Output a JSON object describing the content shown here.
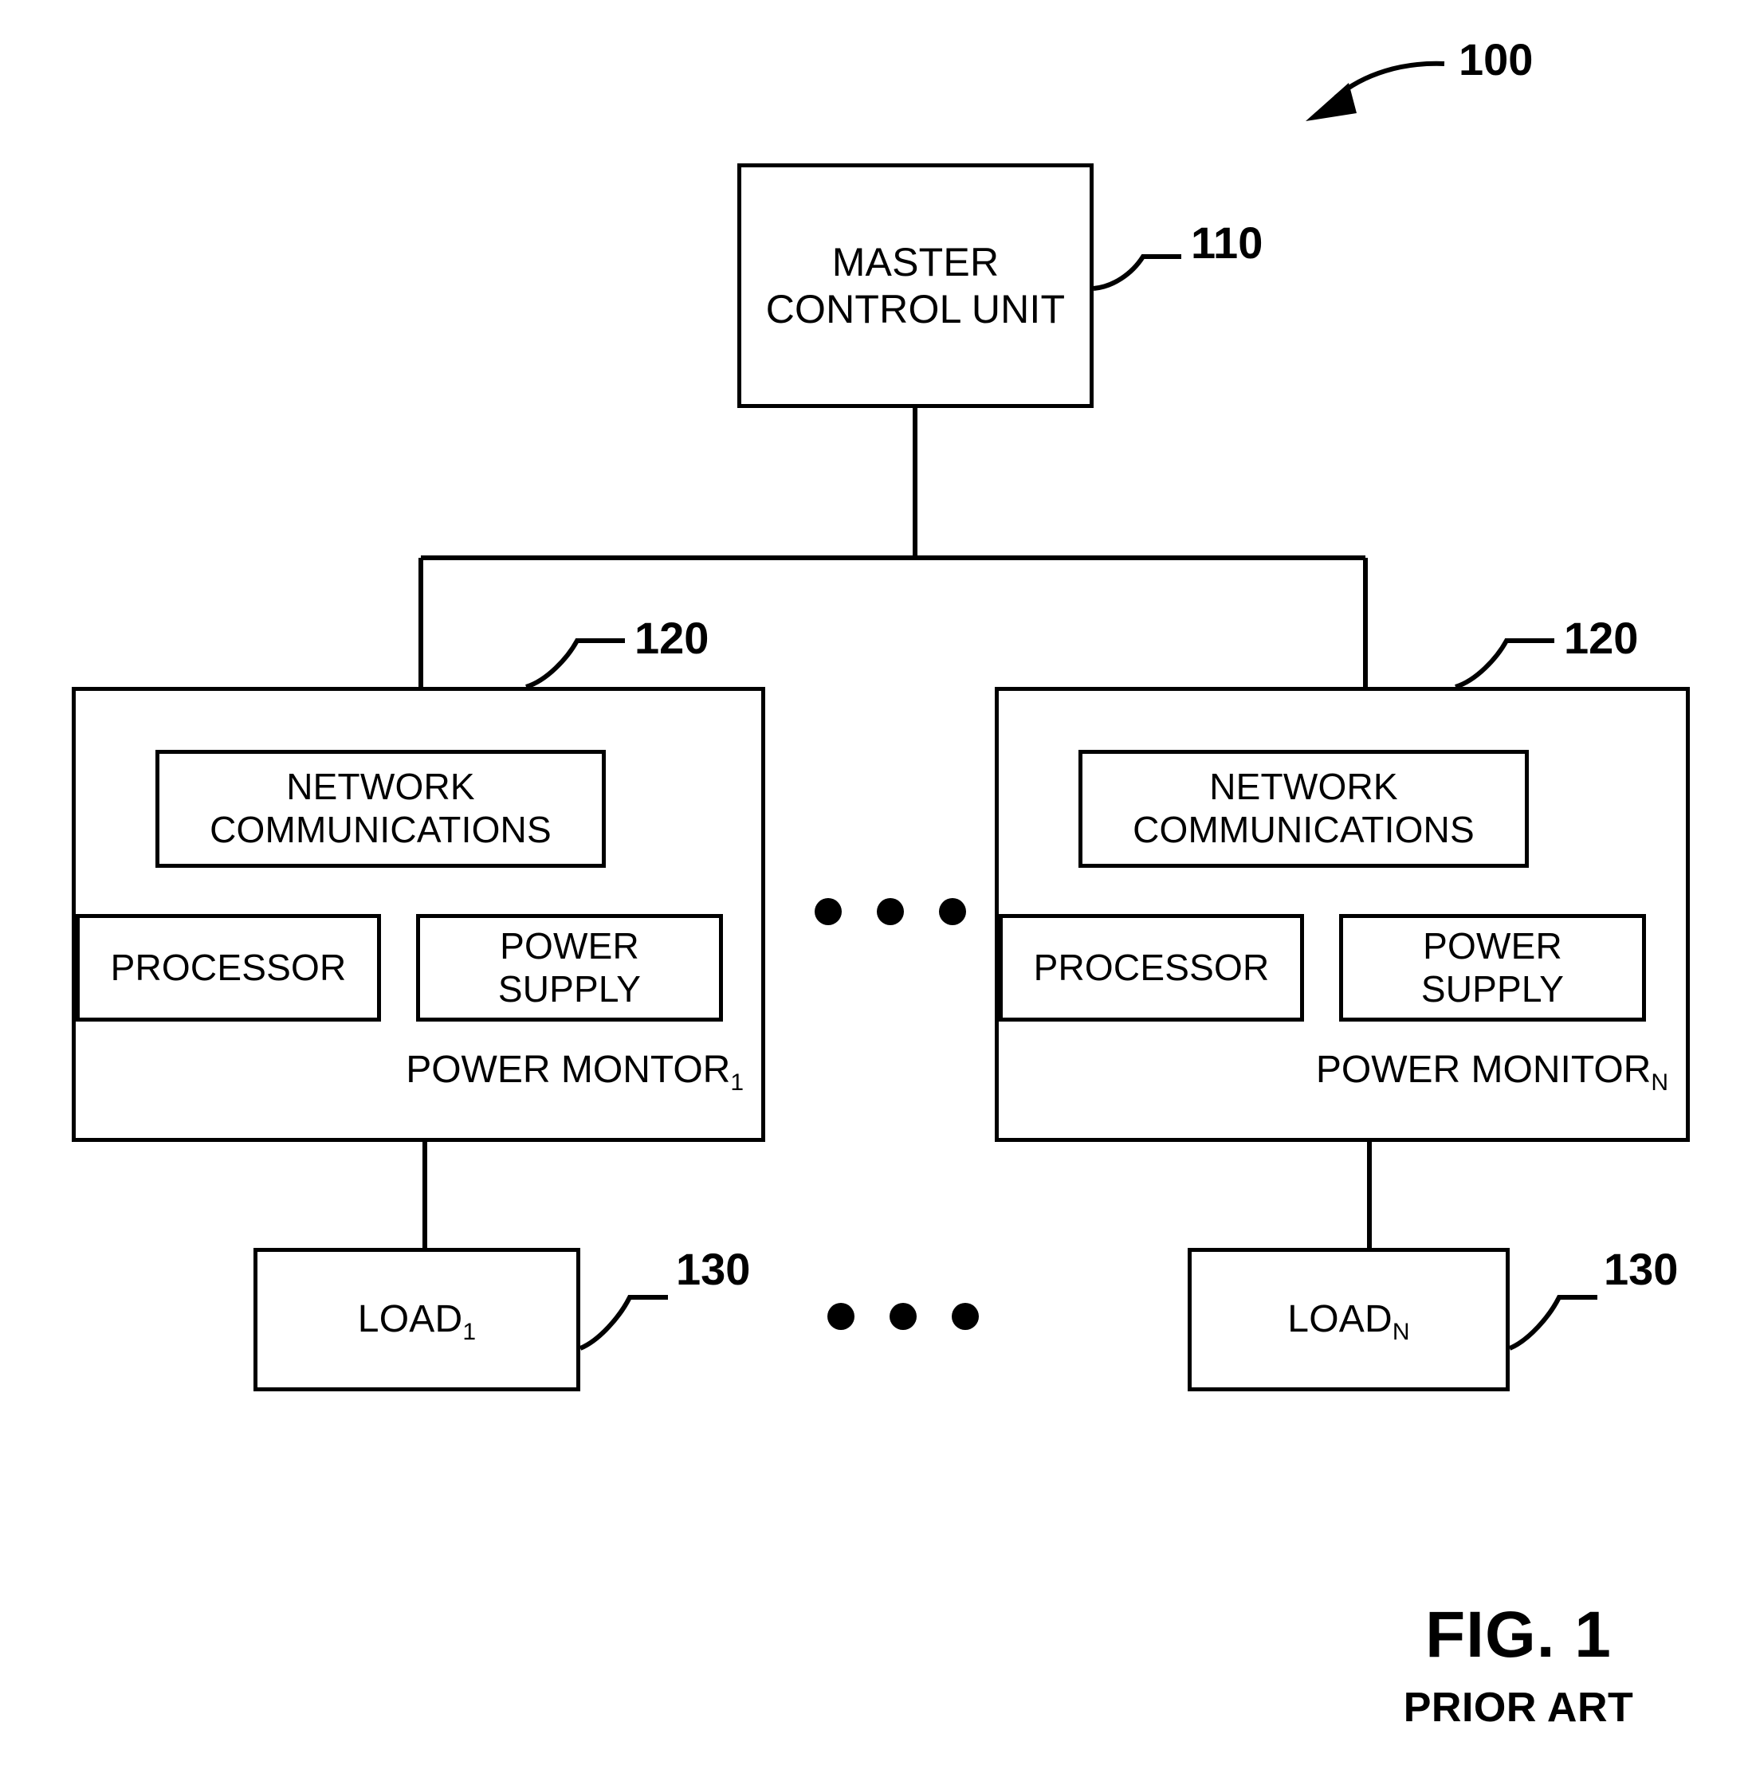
{
  "figure": {
    "title": "FIG. 1",
    "subtitle": "PRIOR ART",
    "system_ref": "100"
  },
  "master_control": {
    "label": "MASTER\nCONTROL UNIT",
    "ref": "110"
  },
  "power_monitors": [
    {
      "caption": "POWER MONTOR",
      "caption_sub": "1",
      "ref": "120",
      "modules": {
        "network": "NETWORK\nCOMMUNICATIONS",
        "processor": "PROCESSOR",
        "power_supply": "POWER\nSUPPLY"
      }
    },
    {
      "caption": "POWER MONITOR",
      "caption_sub": "N",
      "ref": "120",
      "modules": {
        "network": "NETWORK\nCOMMUNICATIONS",
        "processor": "PROCESSOR",
        "power_supply": "POWER\nSUPPLY"
      }
    }
  ],
  "loads": [
    {
      "label": "LOAD",
      "label_sub": "1",
      "ref": "130"
    },
    {
      "label": "LOAD",
      "label_sub": "N",
      "ref": "130"
    }
  ],
  "ellipsis": {
    "monitors_dots": 3,
    "loads_dots": 3
  },
  "colors": {
    "stroke": "#000000",
    "background": "#ffffff"
  }
}
